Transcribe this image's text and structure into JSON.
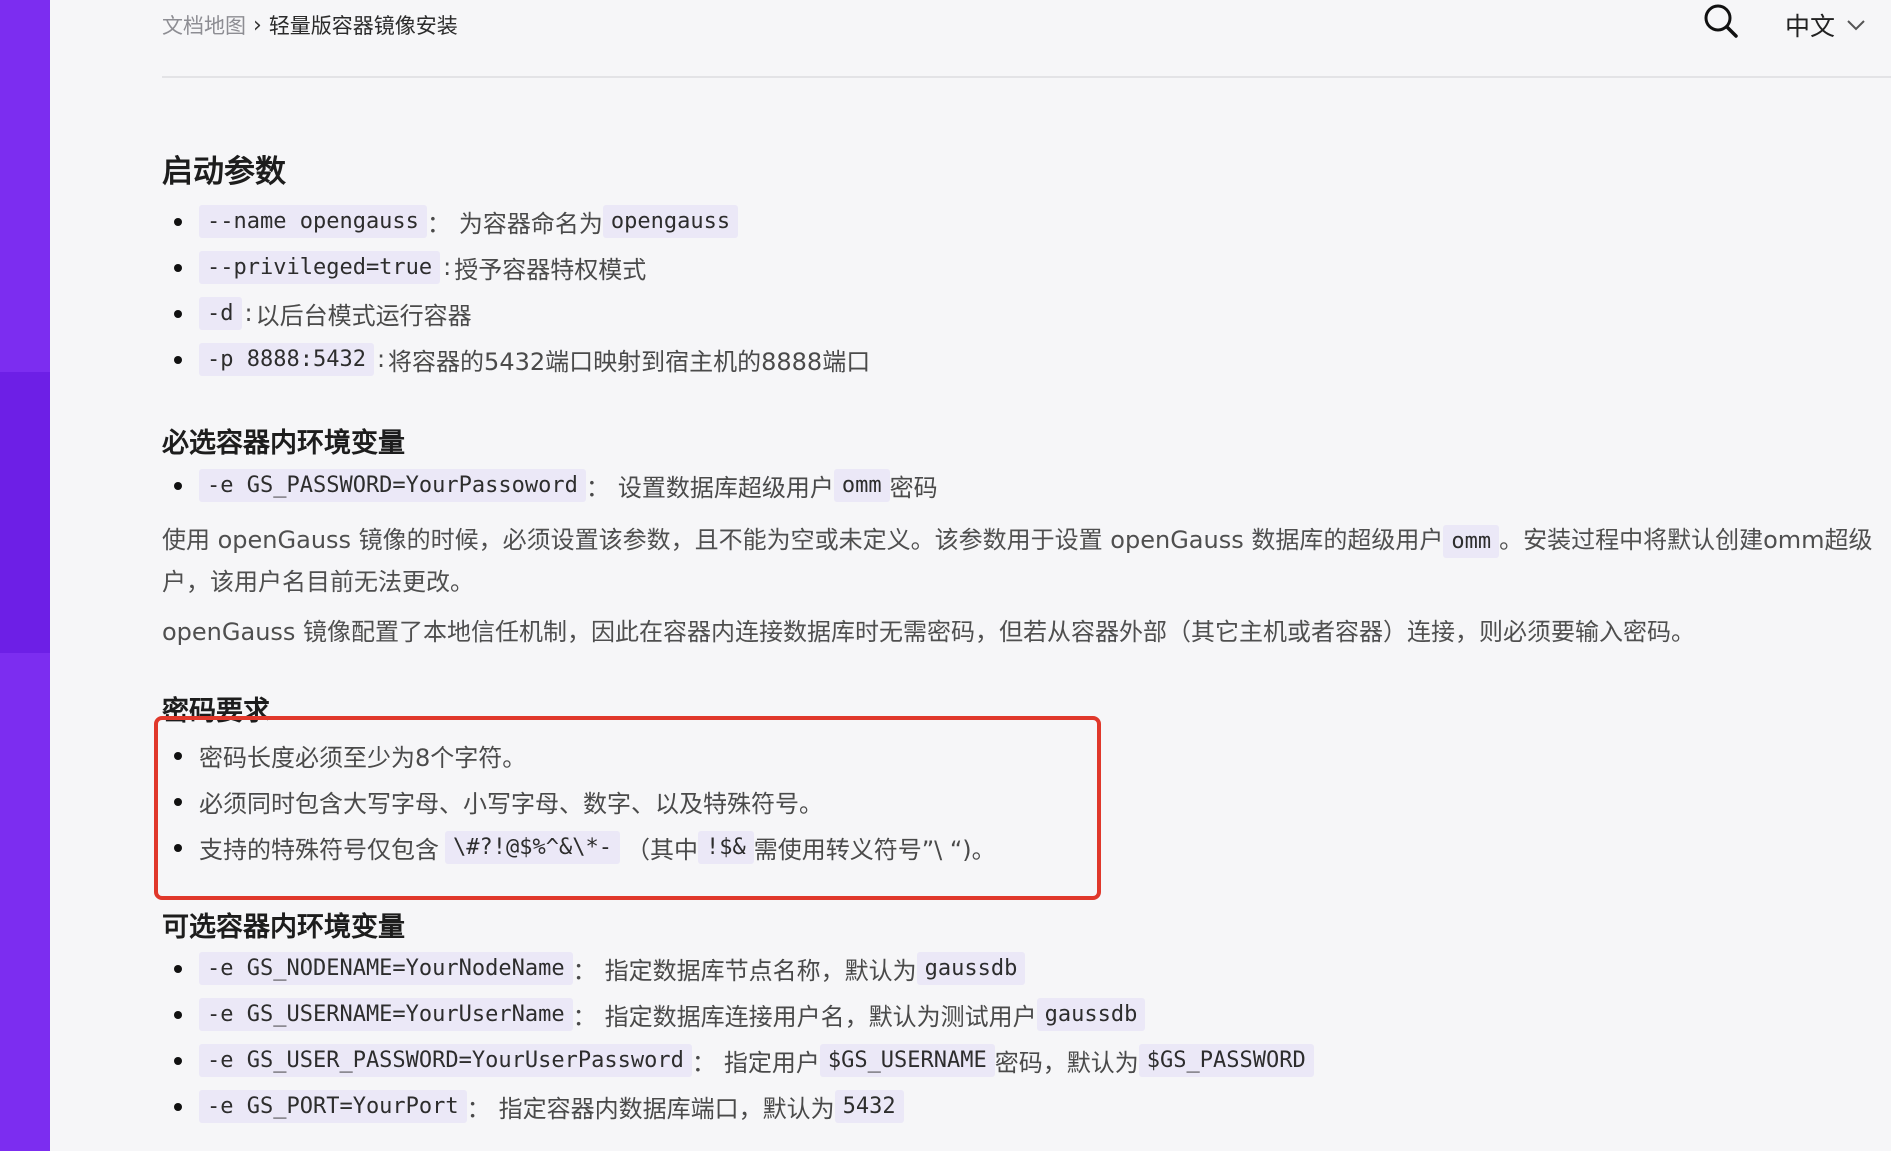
{
  "breadcrumb": {
    "home": "文档地图",
    "separator": "›",
    "current": "轻量版容器镜像安装"
  },
  "header": {
    "language": "中文"
  },
  "sections": {
    "startup": {
      "title": "启动参数",
      "items": [
        {
          "code": "--name opengauss",
          "sep": "：",
          "text": "为容器命名为",
          "code2": "opengauss"
        },
        {
          "code": "--privileged=true",
          "sep": ":",
          "text": "授予容器特权模式"
        },
        {
          "code": "-d",
          "sep": ":",
          "text": "以后台模式运行容器"
        },
        {
          "code": "-p 8888:5432",
          "sep": ":",
          "text": "将容器的5432端口映射到宿主机的8888端口"
        }
      ]
    },
    "required_env": {
      "title": "必选容器内环境变量",
      "item": {
        "code": "-e GS_PASSWORD=YourPassoword",
        "sep": "：",
        "text": "设置数据库超级用户",
        "code2": "omm",
        "text2": "密码"
      },
      "para1_a": "使用 openGauss 镜像的时候，必须设置该参数，且不能为空或未定义。该参数用于设置 openGauss 数据库的超级用户",
      "para1_code": "omm",
      "para1_b": "。安装过程中将默认创建omm超级",
      "para1_c": "户，该用户名目前无法更改。",
      "para2": "openGauss 镜像配置了本地信任机制，因此在容器内连接数据库时无需密码，但若从容器外部（其它主机或者容器）连接，则必须要输入密码。"
    },
    "password_req": {
      "title": "密码要求",
      "item1": "密码长度必须至少为8个字符。",
      "item2": "必须同时包含大写字母、小写字母、数字、以及特殊符号。",
      "item3_a": "支持的特殊符号仅包含",
      "item3_code": "\\#?!@$%^&\\*-",
      "item3_b": "（其中",
      "item3_code2": "!$&",
      "item3_c": "需使用转义符号”\\ “)。"
    },
    "optional_env": {
      "title": "可选容器内环境变量",
      "items": [
        {
          "code": "-e GS_NODENAME=YourNodeName",
          "sep": "：",
          "text": "指定数据库节点名称，默认为",
          "code2": "gaussdb"
        },
        {
          "code": "-e GS_USERNAME=YourUserName",
          "sep": "：",
          "text": "指定数据库连接用户名，默认为测试用户",
          "code2": "gaussdb"
        },
        {
          "code": "-e GS_USER_PASSWORD=YourUserPassword",
          "sep": "：",
          "text": "指定用户",
          "code2": "$GS_USERNAME",
          "text2": "密码，默认为",
          "code3": "$GS_PASSWORD"
        },
        {
          "code": "-e GS_PORT=YourPort",
          "sep": "：",
          "text": "指定容器内数据库端口，默认为",
          "code2": "5432"
        }
      ]
    }
  },
  "colors": {
    "accent_sidebar": "#7c2df0",
    "highlight_border": "#e0382b",
    "code_bg": "#ebe8f7"
  },
  "icons": {
    "search": "search-icon",
    "chevron": "chevron-down-icon"
  }
}
